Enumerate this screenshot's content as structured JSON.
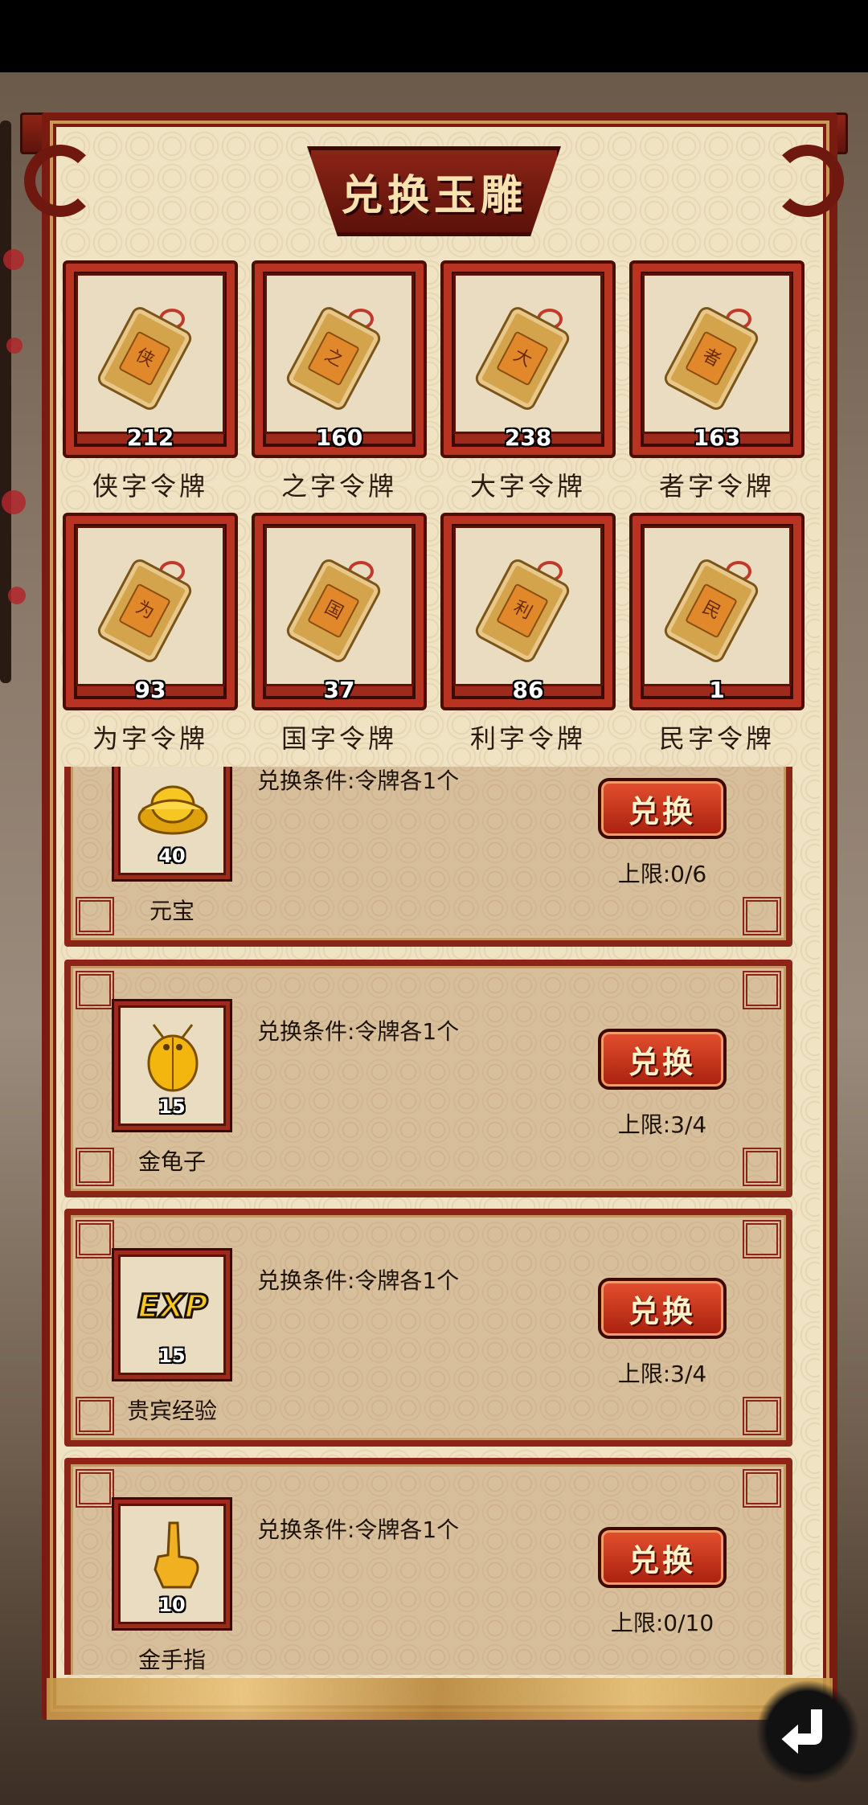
{
  "dialog": {
    "title": "兑换玉雕"
  },
  "tokens": [
    {
      "char": "侠",
      "count": "212",
      "name": "侠字令牌"
    },
    {
      "char": "之",
      "count": "160",
      "name": "之字令牌"
    },
    {
      "char": "大",
      "count": "238",
      "name": "大字令牌"
    },
    {
      "char": "者",
      "count": "163",
      "name": "者字令牌"
    },
    {
      "char": "为",
      "count": "93",
      "name": "为字令牌"
    },
    {
      "char": "国",
      "count": "37",
      "name": "国字令牌"
    },
    {
      "char": "利",
      "count": "86",
      "name": "利字令牌"
    },
    {
      "char": "民",
      "count": "1",
      "name": "民字令牌"
    }
  ],
  "exchanges": [
    {
      "item": "元宝",
      "icon": "gold-ingot-icon",
      "qty": "40",
      "condition": "兑换条件:令牌各1个",
      "button": "兑换",
      "limit": "上限:0/6"
    },
    {
      "item": "金龟子",
      "icon": "golden-beetle-icon",
      "qty": "15",
      "condition": "兑换条件:令牌各1个",
      "button": "兑换",
      "limit": "上限:3/4"
    },
    {
      "item": "贵宾经验",
      "icon": "exp-icon",
      "qty": "15",
      "exp_text": "EXP",
      "condition": "兑换条件:令牌各1个",
      "button": "兑换",
      "limit": "上限:3/4"
    },
    {
      "item": "金手指",
      "icon": "golden-finger-icon",
      "qty": "10",
      "condition": "兑换条件:令牌各1个",
      "button": "兑换",
      "limit": "上限:0/10"
    }
  ],
  "colors": {
    "frame_red": "#8c2517",
    "parchment": "#efe3c4",
    "button_red": "#d3401f"
  }
}
